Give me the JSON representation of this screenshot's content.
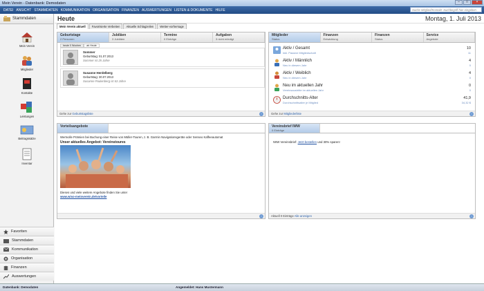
{
  "window": {
    "title": "Mein Verein - Datenbank: Demodaten"
  },
  "menu": [
    "DATEI",
    "ANSICHT",
    "STAMMDATEN",
    "KOMMUNIKATION",
    "ORGANISATION",
    "FINANZEN",
    "AUSWERTUNGEN",
    "LISTEN & DOKUMENTE",
    "HILFE"
  ],
  "search": {
    "placeholder": "Suche Mitglied/Kontakt: Suchbegriff hier eingeben"
  },
  "sidebar": {
    "header": "Stammdaten",
    "items": [
      {
        "label": "Mein Verein",
        "icon": "house-icon"
      },
      {
        "label": "Mitglieder",
        "icon": "members-icon"
      },
      {
        "label": "Kontakte",
        "icon": "contacts-icon"
      },
      {
        "label": "Leistungen",
        "icon": "services-icon"
      },
      {
        "label": "Beitragssätze",
        "icon": "fees-icon"
      },
      {
        "label": "Inventar",
        "icon": "inventory-icon"
      }
    ],
    "nav": [
      {
        "label": "Favoriten",
        "icon": "star-icon"
      },
      {
        "label": "Stammdaten",
        "icon": "stammdaten-icon"
      },
      {
        "label": "Kommunikation",
        "icon": "mail-icon"
      },
      {
        "label": "Organisation",
        "icon": "gear-icon"
      },
      {
        "label": "Finanzen",
        "icon": "coins-icon"
      },
      {
        "label": "Auswertungen",
        "icon": "chart-icon"
      }
    ]
  },
  "main": {
    "title": "Heute",
    "date": "Montag, 1. Juli 2013",
    "tabs": [
      "Mein Verein aktuell",
      "Favorisierte Verbeiten",
      "Aktuelle Schlagzeilen",
      "Wetter-vorhersage"
    ],
    "birthday_panel": {
      "tabs": [
        {
          "title": "Geburtstage",
          "sub": "2 Personen"
        },
        {
          "title": "Jubiläen",
          "sub": "3 Jubiläen"
        },
        {
          "title": "Termine",
          "sub": "0 Einträge"
        },
        {
          "title": "Aufgaben",
          "sub": "3 nicht erledigt"
        }
      ],
      "subtabs": [
        "heute 0 Wochen",
        "ab Heute"
      ],
      "entries": [
        {
          "name": "Sommer",
          "date": "Geburtstag: 01.07.2013",
          "age": "Sommer ist 25 Jahre"
        },
        {
          "name": "Susanne Herdelberg",
          "date": "Geburtstag: 30.07.2013",
          "age": "Susanne Paulenberg ist 63 Jahre"
        }
      ],
      "footer_text": "Gehe zur",
      "footer_link": "Geburtstagsliste"
    },
    "members_panel": {
      "tabs": [
        {
          "title": "Mitglieder",
          "sub": "Status"
        },
        {
          "title": "Finanzen",
          "sub": "Entwicklung"
        },
        {
          "title": "Finanzen",
          "sub": "Status"
        },
        {
          "title": "Service",
          "sub": "Angebote"
        }
      ],
      "rows": [
        {
          "label": "Aktiv / Gesamt",
          "sub": "inkl. Passive Mitgliedschaft",
          "value": "10",
          "value2": "11",
          "icon": "group-icon"
        },
        {
          "label": "Aktiv / Männlich",
          "sub": "Neu in diesem Jahr",
          "value": "4",
          "value2": "0",
          "icon": "male-icon"
        },
        {
          "label": "Aktiv / Weiblich",
          "sub": "Neu in diesem Jahr",
          "value": "4",
          "value2": "0",
          "icon": "female-icon"
        },
        {
          "label": "Neu im aktuellen Jahr",
          "sub": "Vereinsaustritte im aktuellen Jahr",
          "value": "0",
          "value2": "0",
          "icon": "new-member-icon"
        },
        {
          "label": "Durchschnitts-Alter",
          "sub": "Durchschnittsalter je Mitglied",
          "value": "41,9",
          "value2": "34,32 $",
          "icon": "age-icon"
        }
      ],
      "footer_text": "Gehe zur",
      "footer_link": "Mitgliederliste"
    },
    "offers_panel": {
      "tab": "Vorteilsangebote",
      "line1": "Wertvolle Prämien bei Buchung einer Reise von Müller-Touren, z. B. Garmin Navigationsgeräte oder Senseo Kaffeeautomat",
      "headline": "Unser aktuelles Angebot: Vereinstoures",
      "line2": "Dieses und viele weitere Angebote finden Sie unter",
      "link": "www.wiso-meinverein.de/vorteile"
    },
    "newsletter_panel": {
      "tab": "Vereinsbrief IWW",
      "tab_sub": "0 Einträge",
      "text_pre": "IWW Vereinsbrief:",
      "text_link": "Jetzt bestellen",
      "text_post": "und 30% sparen!",
      "footer_text": "Aktuell 0 Einträge",
      "footer_link": "Alle anzeigen"
    }
  },
  "status": {
    "db": "Datenbank: Demodaten",
    "user": "Angemeldet: Hans Mustermann"
  },
  "colors": {
    "menubar": "#2b568f",
    "accent": "#2a5fa8",
    "tab_active": "#c9dcf2"
  }
}
